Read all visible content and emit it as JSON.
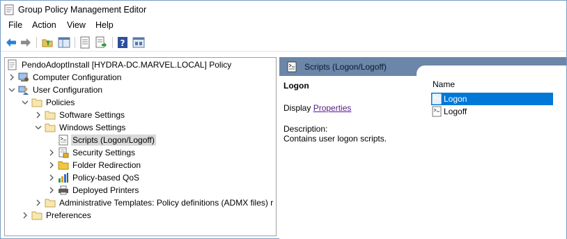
{
  "window": {
    "title": "Group Policy Management Editor"
  },
  "menu": [
    "File",
    "Action",
    "View",
    "Help"
  ],
  "toolbar": {
    "buttons": [
      "back-icon",
      "forward-icon",
      "up-folder-icon",
      "show-hide-tree-icon",
      "properties-icon",
      "export-list-icon",
      "help-icon",
      "view-icon"
    ]
  },
  "tree": {
    "root": "PendoAdoptInstall [HYDRA-DC.MARVEL.LOCAL] Policy",
    "computer_configuration": "Computer Configuration",
    "user_configuration": "User Configuration",
    "policies": "Policies",
    "software_settings": "Software Settings",
    "windows_settings": "Windows Settings",
    "scripts": "Scripts (Logon/Logoff)",
    "security_settings": "Security Settings",
    "folder_redirection": "Folder Redirection",
    "policy_qos": "Policy-based QoS",
    "deployed_printers": "Deployed Printers",
    "admin_templates": "Administrative Templates: Policy definitions (ADMX files) r",
    "preferences": "Preferences"
  },
  "right": {
    "header_title": "Scripts (Logon/Logoff)",
    "detail_heading": "Logon",
    "display_prefix": "Display ",
    "properties_link": "Properties ",
    "description_label": "Description:",
    "description_text": "Contains user logon scripts.",
    "column_name": "Name",
    "items": [
      "Logon",
      "Logoff"
    ]
  },
  "colors": {
    "selection": "#0078d7",
    "header_band": "#6b86a8",
    "link": "#551a8b"
  }
}
